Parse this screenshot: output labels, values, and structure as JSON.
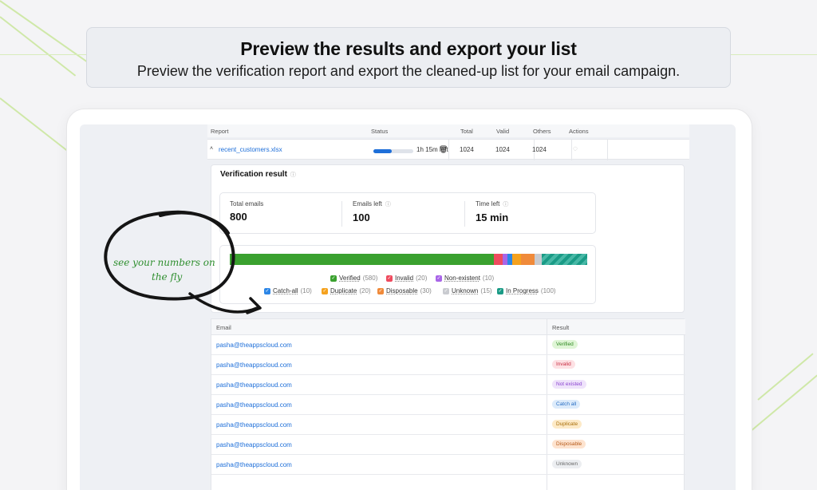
{
  "hero": {
    "title": "Preview the results and export your list",
    "subtitle": "Preview the verification report and export the cleaned-up list for your email campaign."
  },
  "report_table": {
    "headers": {
      "report": "Report",
      "status": "Status",
      "total": "Total",
      "valid": "Valid",
      "others": "Others",
      "actions": "Actions"
    },
    "row": {
      "file": "recent_customers.xlsx",
      "progress": 0.45,
      "time_left": "1h 15m left",
      "total": "1024",
      "valid": "1024",
      "others": "1024"
    }
  },
  "verification": {
    "title": "Verification result",
    "stats": [
      {
        "label": "Total emails",
        "value": "800"
      },
      {
        "label": "Emails left",
        "value": "100"
      },
      {
        "label": "Time left",
        "value": "15 min"
      }
    ],
    "chart_data": {
      "type": "bar",
      "categories": [
        "Verified",
        "Invalid",
        "Non-existent",
        "Catch-all",
        "Duplicate",
        "Disposable",
        "Unknown",
        "In Progress"
      ],
      "values": [
        580,
        20,
        10,
        10,
        20,
        30,
        15,
        100
      ],
      "colors": [
        "#3aa12f",
        "#ef4b5e",
        "#a965e8",
        "#2c86e6",
        "#f5a21e",
        "#f08a3a",
        "#c9cbd0",
        "#1a9b86"
      ]
    },
    "legend": [
      {
        "label": "Verified",
        "count": "(580)",
        "color": "#3aa12f"
      },
      {
        "label": "Invalid",
        "count": "(20)",
        "color": "#ef4b5e"
      },
      {
        "label": "Non-existent",
        "count": "(10)",
        "color": "#a965e8"
      },
      {
        "label": "Catch-all",
        "count": "(10)",
        "color": "#2c86e6"
      },
      {
        "label": "Duplicate",
        "count": "(20)",
        "color": "#f5a21e"
      },
      {
        "label": "Disposable",
        "count": "(30)",
        "color": "#f08a3a"
      },
      {
        "label": "Unknown",
        "count": "(15)",
        "color": "#c9cbd0"
      },
      {
        "label": "In Progress",
        "count": "(100)",
        "color": "#1a9b86"
      }
    ]
  },
  "email_table": {
    "headers": {
      "email": "Email",
      "result": "Result"
    },
    "rows": [
      {
        "email": "pasha@theappscloud.com",
        "result": "Verified",
        "bg": "#dff5d6",
        "fg": "#2f8a22"
      },
      {
        "email": "pasha@theappscloud.com",
        "result": "Invalid",
        "bg": "#fde1e4",
        "fg": "#c93044"
      },
      {
        "email": "pasha@theappscloud.com",
        "result": "Not existed",
        "bg": "#efe3fb",
        "fg": "#8b45d0"
      },
      {
        "email": "pasha@theappscloud.com",
        "result": "Catch all",
        "bg": "#dcebfb",
        "fg": "#2a6fc4"
      },
      {
        "email": "pasha@theappscloud.com",
        "result": "Duplicate",
        "bg": "#fdeac7",
        "fg": "#a86d08"
      },
      {
        "email": "pasha@theappscloud.com",
        "result": "Disposable",
        "bg": "#fde3cf",
        "fg": "#b65918"
      },
      {
        "email": "pasha@theappscloud.com",
        "result": "Unknown",
        "bg": "#eceef1",
        "fg": "#666"
      }
    ]
  },
  "annotation": {
    "line1": "see your numbers on",
    "line2": "the fly"
  }
}
